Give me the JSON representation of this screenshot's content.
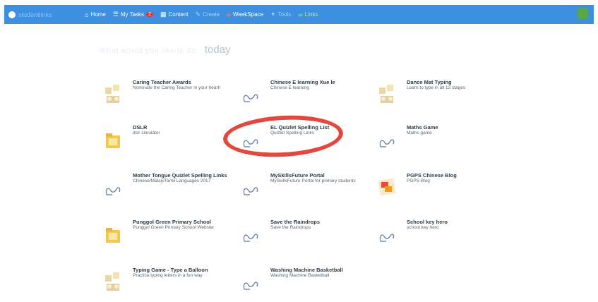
{
  "header": {
    "logo_text": "studentlinks",
    "nav": [
      {
        "label": "Home",
        "icon": "home-icon"
      },
      {
        "label": "My Tasks",
        "icon": "tasks-icon",
        "badge": "2"
      },
      {
        "label": "Content",
        "icon": "content-icon"
      },
      {
        "label": "Create",
        "icon": "create-icon"
      },
      {
        "label": "WeekSpace",
        "icon": "workspace-icon"
      },
      {
        "label": "Tools",
        "icon": "tools-icon"
      },
      {
        "label": "Links",
        "icon": "links-icon"
      }
    ]
  },
  "main": {
    "heading_faint": "What would you like to do",
    "heading_today": "today"
  },
  "cards": [
    {
      "title": "Caring Teacher Awards",
      "desc": "Nominate the Caring Teacher in your heart!",
      "thumb": "award"
    },
    {
      "title": "Chinese E learning Xue le",
      "desc": "Chinese E learning",
      "thumb": "link"
    },
    {
      "title": "Dance Mat Typing",
      "desc": "Learn to type in all 12 stages",
      "thumb": "award"
    },
    {
      "title": "DSLR",
      "desc": "dslr simulator",
      "thumb": "folder"
    },
    {
      "title": "EL Quizlet Spelling List",
      "desc": "Quizlet Spelling Links",
      "thumb": "link"
    },
    {
      "title": "Maths Game",
      "desc": "Maths game",
      "thumb": "link"
    },
    {
      "title": "Mother Tongue Quizlet Spelling Links",
      "desc": "Chinese/Malay/Tamil Languages 2017",
      "thumb": "link"
    },
    {
      "title": "MySkillsFuture Portal",
      "desc": "MySkillsFuture Portal for primary students",
      "thumb": "link"
    },
    {
      "title": "PGPS Chinese Blog",
      "desc": "PGPS Blog",
      "thumb": "photo"
    },
    {
      "title": "Punggol Green Primary School",
      "desc": "Punggol Green Primary School Website",
      "thumb": "folder"
    },
    {
      "title": "Save the Raindrops",
      "desc": "Save the Raindrops",
      "thumb": "link"
    },
    {
      "title": "School key hero",
      "desc": "school key hero",
      "thumb": "link"
    },
    {
      "title": "Typing Game - Type a Balloon",
      "desc": "Practice typing letters in a fun way",
      "thumb": "award"
    },
    {
      "title": "Washing Machine Basketball",
      "desc": "Washing Machine Basketball",
      "thumb": "link"
    }
  ],
  "colors": {
    "topbar": "#3d8fe0",
    "highlight_ring": "#e2483d"
  }
}
